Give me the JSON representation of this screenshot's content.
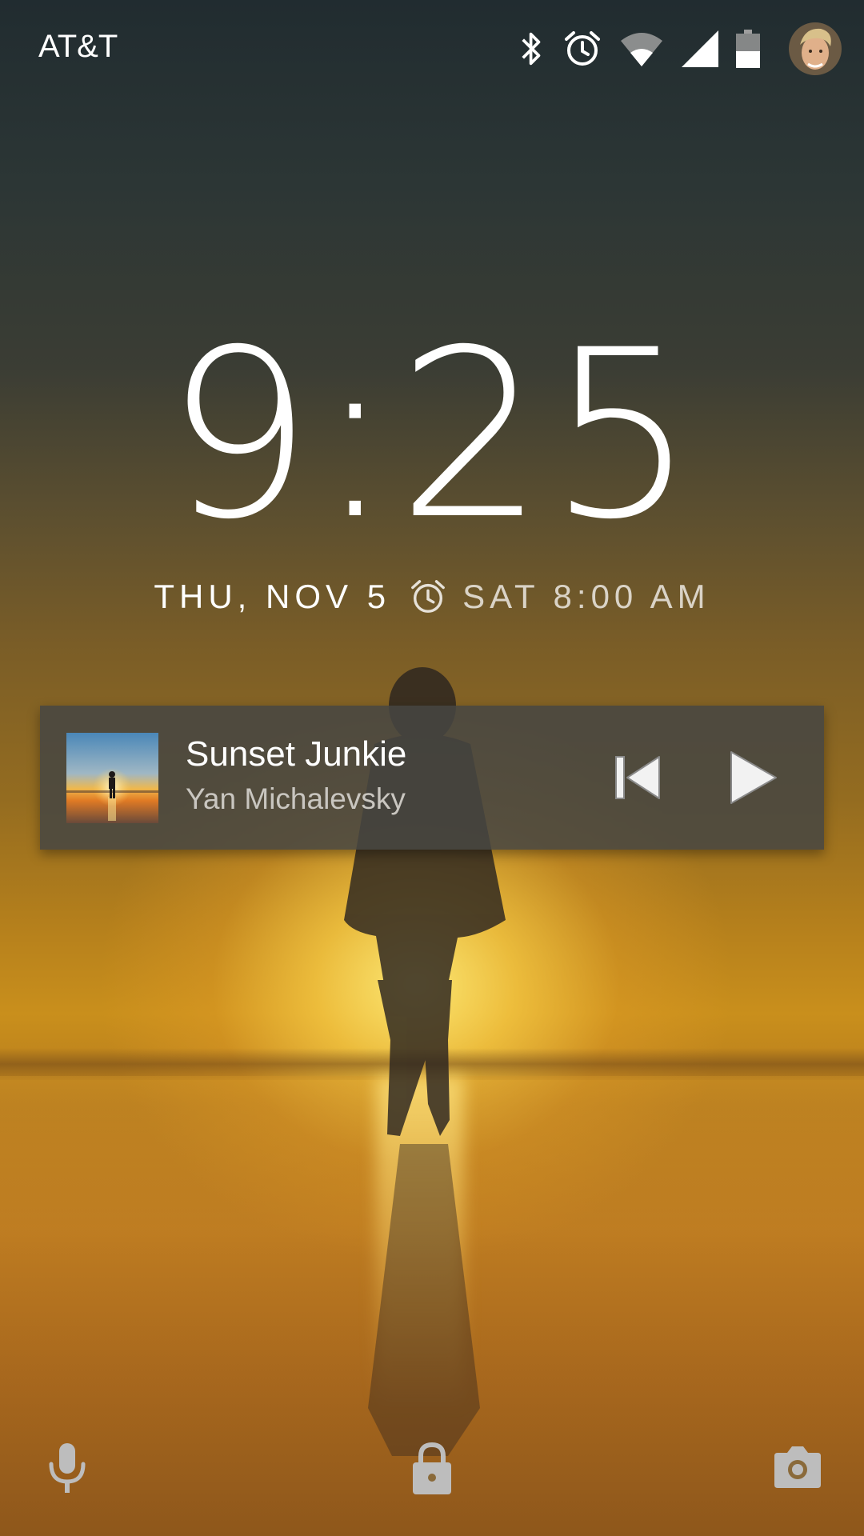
{
  "status_bar": {
    "carrier": "AT&T",
    "icons": [
      "bluetooth-icon",
      "alarm-icon",
      "wifi-icon",
      "cell-signal-icon",
      "battery-icon",
      "avatar"
    ]
  },
  "lockscreen": {
    "time": "9:25",
    "date": "THU, NOV 5",
    "next_alarm": "SAT 8:00 AM"
  },
  "media": {
    "title": "Sunset Junkie",
    "artist": "Yan Michalevsky",
    "controls": [
      "previous-icon",
      "play-icon"
    ]
  },
  "bottom_actions": [
    "microphone-icon",
    "lock-icon",
    "camera-icon"
  ],
  "colors": {
    "text_primary": "#ffffff",
    "card_background": "#46463f",
    "icon_gray": "#bdbdbd"
  }
}
